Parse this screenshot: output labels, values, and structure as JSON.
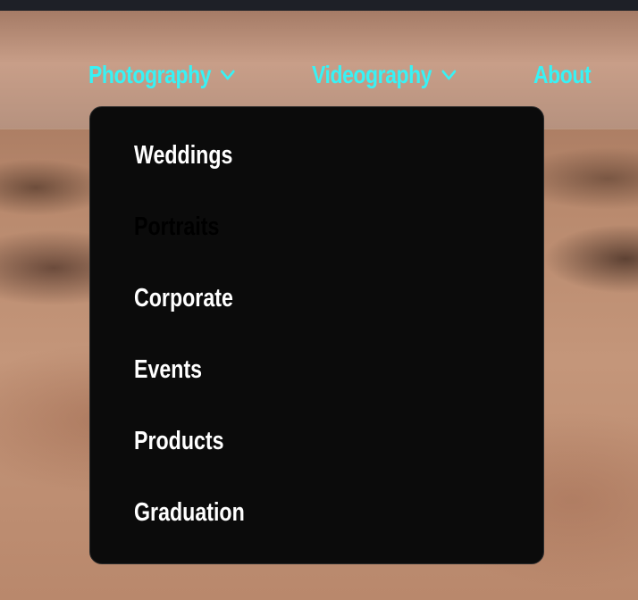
{
  "nav": {
    "items": [
      {
        "label": "Photography",
        "has_dropdown": true,
        "icon": "chevron-down-icon"
      },
      {
        "label": "Videography",
        "has_dropdown": true,
        "icon": "chevron-down-icon"
      },
      {
        "label": "About",
        "has_dropdown": false
      }
    ],
    "color": "#38f2f5"
  },
  "dropdown": {
    "items": [
      {
        "label": "Weddings"
      },
      {
        "label": "Portraits",
        "state": "hovered"
      },
      {
        "label": "Corporate"
      },
      {
        "label": "Events"
      },
      {
        "label": "Products"
      },
      {
        "label": "Graduation"
      }
    ],
    "background": "#0b0b0b",
    "text_color": "#ffffff"
  }
}
